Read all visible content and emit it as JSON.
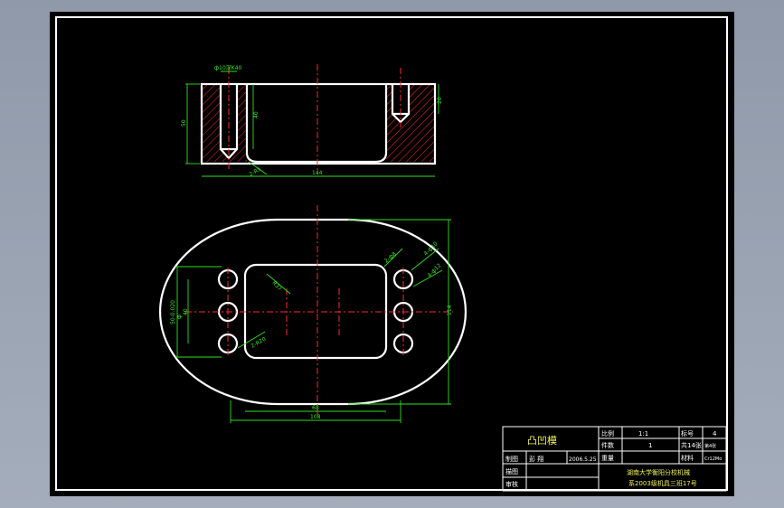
{
  "dimensions": {
    "hole_note": "ф10深K40",
    "height_50": "50",
    "depth_40": "40",
    "depth_20": "20",
    "length_144": "144",
    "fillet_r5": "2-R5",
    "radius_r37": "R37",
    "bolt_holes_2": "2-ф8",
    "bolt_holes_4": "4-ф10",
    "bolt_holes_4b": "4-ф12",
    "inner_r20": "2-R20",
    "width_phi": "ф",
    "width_50": "50-0.020",
    "width_40": "40",
    "height_114": "114",
    "len_68": "68",
    "len_108": "108"
  },
  "title_block": {
    "part_name": "凸凹模",
    "scale_label": "比例",
    "scale_value": "1:1",
    "sheet_label": "标号",
    "sheet_value": "4",
    "qty_label": "件数",
    "qty_value": "1",
    "sheets_label": "共14张",
    "sheet_index": "第4张",
    "weight_label": "重量",
    "material_label": "材料",
    "material_value": "Cr12Mo",
    "drawn_label": "制图",
    "drawn_name": "彭   翔",
    "drawn_date": "2006.5.25",
    "design_label": "描图",
    "check_label": "审核",
    "school_line1": "湖南大学衡阳分校机械",
    "school_line2": "系2003级机具三班17号"
  }
}
